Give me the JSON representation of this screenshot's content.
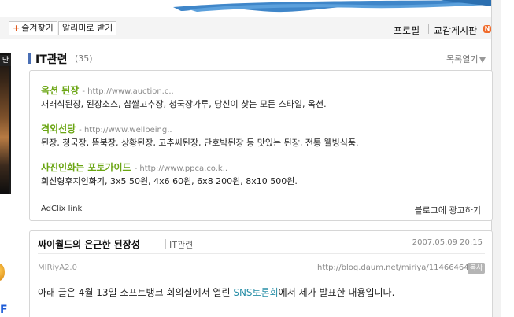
{
  "toolbar": {
    "favorite_label": "즐겨찾기",
    "favorite_plus": "+",
    "notify_label": "알리미로 받기",
    "profile_label": "프로필",
    "guestbook_label": "교감게시판",
    "new_badge": "N"
  },
  "sidebar": {
    "image_caption": "단"
  },
  "category": {
    "title": "IT관련",
    "count": "(35)",
    "list_toggle": "목록열기"
  },
  "ads": {
    "items": [
      {
        "title": "옥션 된장",
        "url": "- http://www.auction.c..",
        "desc": "재래식된장, 된장소스, 찹쌀고추장, 청국장가루, 당신이 찾는 모든 스타일, 옥션."
      },
      {
        "title": "격외선당",
        "url": "- http://www.wellbeing..",
        "desc": "된장, 청국장, 뜸북장, 상황된장, 고추씨된장, 단호박된장 등 맛있는 된장, 전통 웰빙식품."
      },
      {
        "title": "사진인화는 포토가이드",
        "url": "- http://www.ppca.co.k..",
        "desc": "회신형후지인화기, 3x5 50원, 4x6 60원, 6x8 200원, 8x10 500원."
      }
    ],
    "footer_left": "AdClix link",
    "footer_right": "블로그에 광고하기"
  },
  "post": {
    "title": "싸이월드의 은근한 된장성",
    "category": "IT관련",
    "date": "2007.05.09 20:15",
    "author": "MIRiyA2.0",
    "url": "http://blog.daum.net/miriya/11466464",
    "copy_label": "복사",
    "body_before": "아래 글은 4월 13일 소프트뱅크 회의실에서 열린 ",
    "body_link": "SNS토론회",
    "body_after": "에서 제가 발표한 내용입니다."
  },
  "colors": {
    "ad_title": "#6aa512",
    "link": "#2a8fa7",
    "category_bar": "#4a6fb5",
    "new_badge": "#f06a2a"
  }
}
